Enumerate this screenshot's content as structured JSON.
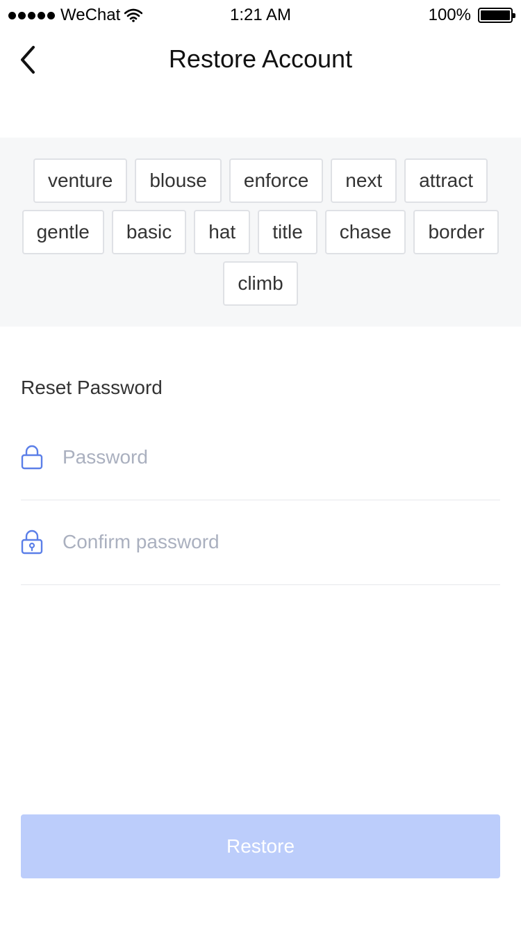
{
  "status_bar": {
    "carrier": "WeChat",
    "time": "1:21 AM",
    "battery": "100%"
  },
  "nav": {
    "title": "Restore Account"
  },
  "mnemonic": {
    "rows": [
      [
        "venture",
        "blouse",
        "enforce",
        "next",
        "attract"
      ],
      [
        "gentle",
        "basic",
        "hat",
        "title",
        "chase",
        "border"
      ],
      [
        "climb"
      ]
    ]
  },
  "reset": {
    "label": "Reset Password",
    "password_placeholder": "Password",
    "password_value": "",
    "confirm_placeholder": "Confirm password",
    "confirm_value": ""
  },
  "actions": {
    "restore_label": "Restore"
  },
  "colors": {
    "accent": "#5b7fe8",
    "button_disabled": "#bccdfb",
    "panel_bg": "#f6f7f8"
  }
}
